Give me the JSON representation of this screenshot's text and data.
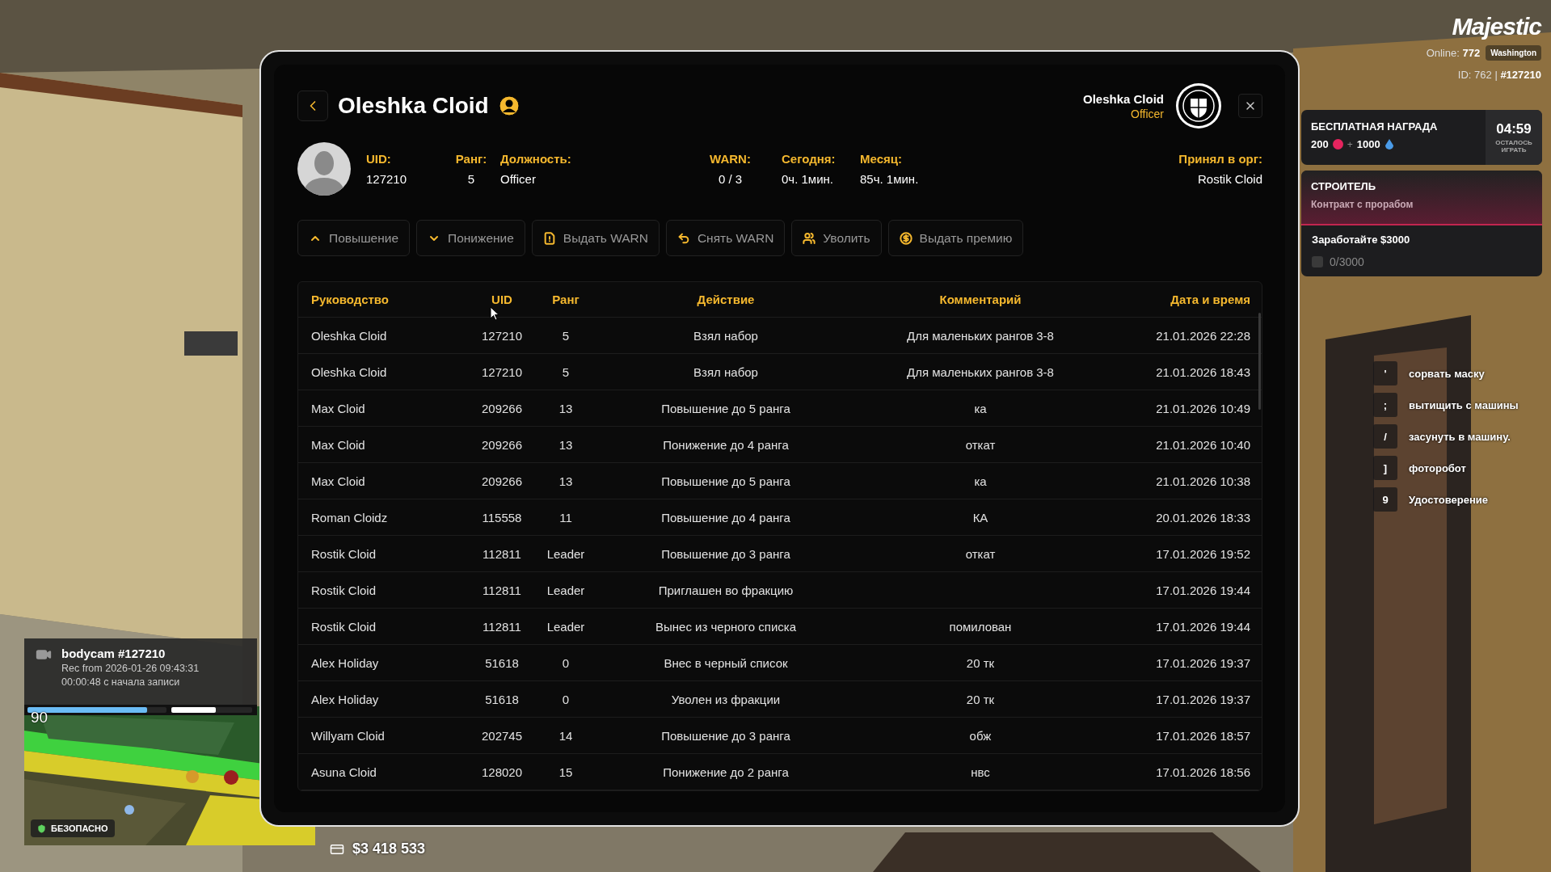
{
  "hud": {
    "logo": "Majestic",
    "online": "Online: **772**",
    "server": "Washington",
    "player_id": "ID: 762 | **#127210**"
  },
  "reward": {
    "title": "БЕСПЛАТНАЯ НАГРАДА",
    "amount_1": "200",
    "plus": "+",
    "amount_2": "1000",
    "timer": "04:59",
    "timer_caption": "ОСТАЛОСЬ ИГРАТЬ"
  },
  "quest": {
    "title": "СТРОИТЕЛЬ",
    "subtitle": "Контракт с прорабом",
    "task": "Заработайте $3000",
    "checked": false,
    "progress": "0/3000"
  },
  "keybinds": [
    {
      "key": "'",
      "label": "сорвать маску"
    },
    {
      "key": ";",
      "label": "вытищить с машины"
    },
    {
      "key": "/",
      "label": "засунуть в машину."
    },
    {
      "key": "]",
      "label": "фоторобот"
    },
    {
      "key": "9",
      "label": "Удостоверение"
    }
  ],
  "bodycam": {
    "title": "bodycam #127210",
    "recorded": "Rec from 2026-01-26 09:43:31",
    "elapsed": "00:00:48 с начала записи"
  },
  "vitals": [
    {
      "kind": "health",
      "level": 0.86
    },
    {
      "kind": "armor",
      "level": 0.55
    }
  ],
  "minimap": {
    "heading": "90",
    "zone": "БЕЗОПАСНО"
  },
  "money": {
    "bank": "$3 418 533"
  },
  "profile": {
    "title": "Oleshka Cloid",
    "user": {
      "name": "Oleshka Cloid",
      "role": "Officer"
    },
    "stats": [
      {
        "label": "UID:",
        "value": "127210"
      },
      {
        "label": "Ранг:",
        "value": "5"
      },
      {
        "label": "Должность:",
        "value": "Officer"
      },
      {
        "label": "WARN:",
        "value": "0 / 3"
      },
      {
        "label": "Сегодня:",
        "value": "0ч. 1мин."
      },
      {
        "label": "Месяц:",
        "value": "85ч. 1мин."
      }
    ],
    "accepted_by": {
      "label": "Принял в орг:",
      "value": "Rostik Cloid"
    },
    "actions": [
      {
        "kind": "promote",
        "label": "Повышение"
      },
      {
        "kind": "demote",
        "label": "Понижение"
      },
      {
        "kind": "warn",
        "label": "Выдать WARN"
      },
      {
        "kind": "unwarn",
        "label": "Снять WARN"
      },
      {
        "kind": "fire",
        "label": "Уволить"
      },
      {
        "kind": "bonus",
        "label": "Выдать премию"
      }
    ],
    "table": {
      "columns": [
        "Руководство",
        "UID",
        "Ранг",
        "Действие",
        "Комментарий",
        "Дата и время"
      ],
      "rows": [
        [
          "Oleshka Cloid",
          "127210",
          "5",
          "Взял набор",
          "Для маленьких рангов 3-8",
          "21.01.2026 22:28"
        ],
        [
          "Oleshka Cloid",
          "127210",
          "5",
          "Взял набор",
          "Для маленьких рангов 3-8",
          "21.01.2026 18:43"
        ],
        [
          "Max Cloid",
          "209266",
          "13",
          "Повышение до 5 ранга",
          "ка",
          "21.01.2026 10:49"
        ],
        [
          "Max Cloid",
          "209266",
          "13",
          "Понижение до 4 ранга",
          "откат",
          "21.01.2026 10:40"
        ],
        [
          "Max Cloid",
          "209266",
          "13",
          "Повышение до 5 ранга",
          "ка",
          "21.01.2026 10:38"
        ],
        [
          "Roman Cloidz",
          "115558",
          "11",
          "Повышение до 4 ранга",
          "КА",
          "20.01.2026 18:33"
        ],
        [
          "Rostik Cloid",
          "112811",
          "Leader",
          "Повышение до 3 ранга",
          "откат",
          "17.01.2026 19:52"
        ],
        [
          "Rostik Cloid",
          "112811",
          "Leader",
          "Приглашен во фракцию",
          "",
          "17.01.2026 19:44"
        ],
        [
          "Rostik Cloid",
          "112811",
          "Leader",
          "Вынес из черного списка",
          "помилован",
          "17.01.2026 19:44"
        ],
        [
          "Alex Holiday",
          "51618",
          "0",
          "Внес в черный список",
          "20 тк",
          "17.01.2026 19:37"
        ],
        [
          "Alex Holiday",
          "51618",
          "0",
          "Уволен из фракции",
          "20 тк",
          "17.01.2026 19:37"
        ],
        [
          "Willyam Cloid",
          "202745",
          "14",
          "Повышение до 3 ранга",
          "обж",
          "17.01.2026 18:57"
        ],
        [
          "Asuna Cloid",
          "128020",
          "15",
          "Понижение до 2 ранга",
          "нвс",
          "17.01.2026 18:56"
        ]
      ]
    }
  }
}
